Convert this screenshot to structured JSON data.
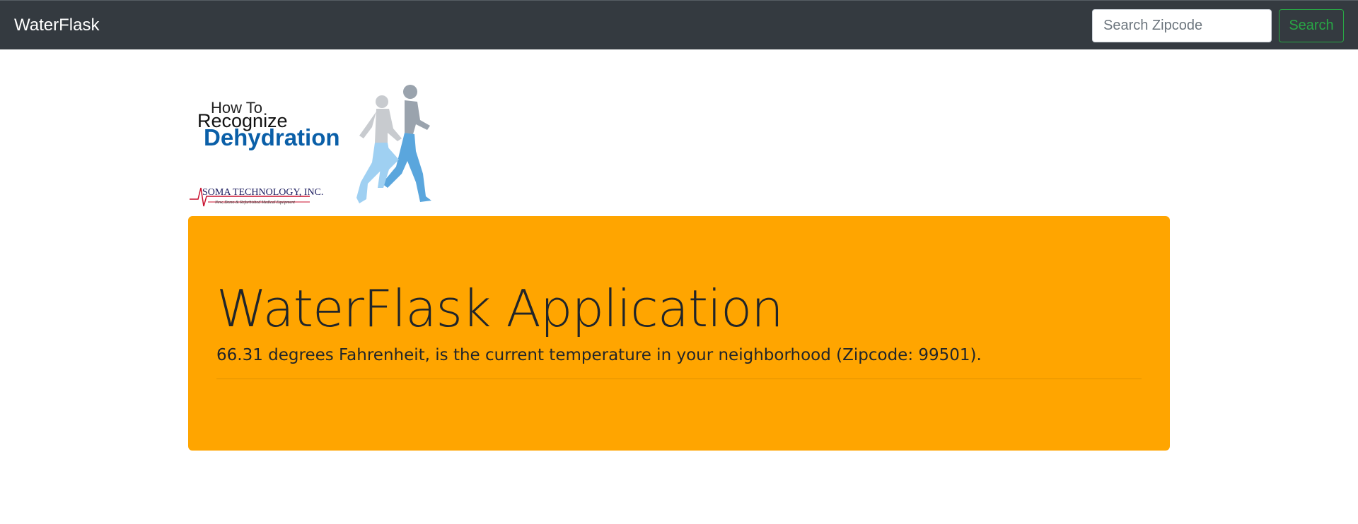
{
  "navbar": {
    "brand": "WaterFlask",
    "search": {
      "placeholder": "Search Zipcode",
      "value": ""
    },
    "search_button_label": "Search"
  },
  "logo": {
    "line1": "How To",
    "line2": "Recognize",
    "line3": "Dehydration",
    "company": "SOMA TECHNOLOGY, INC.",
    "company_sub": "New, Demo & Refurbished Medical Equipment"
  },
  "jumbotron": {
    "title": "WaterFlask Application",
    "lead": "66.31 degrees Fahrenheit, is the current temperature in your neighborhood (Zipcode: 99501)."
  },
  "colors": {
    "navbar_bg": "#343a40",
    "jumbotron_bg": "#ffa500",
    "search_button": "#28a745",
    "logo_blue": "#0a5fa8"
  }
}
